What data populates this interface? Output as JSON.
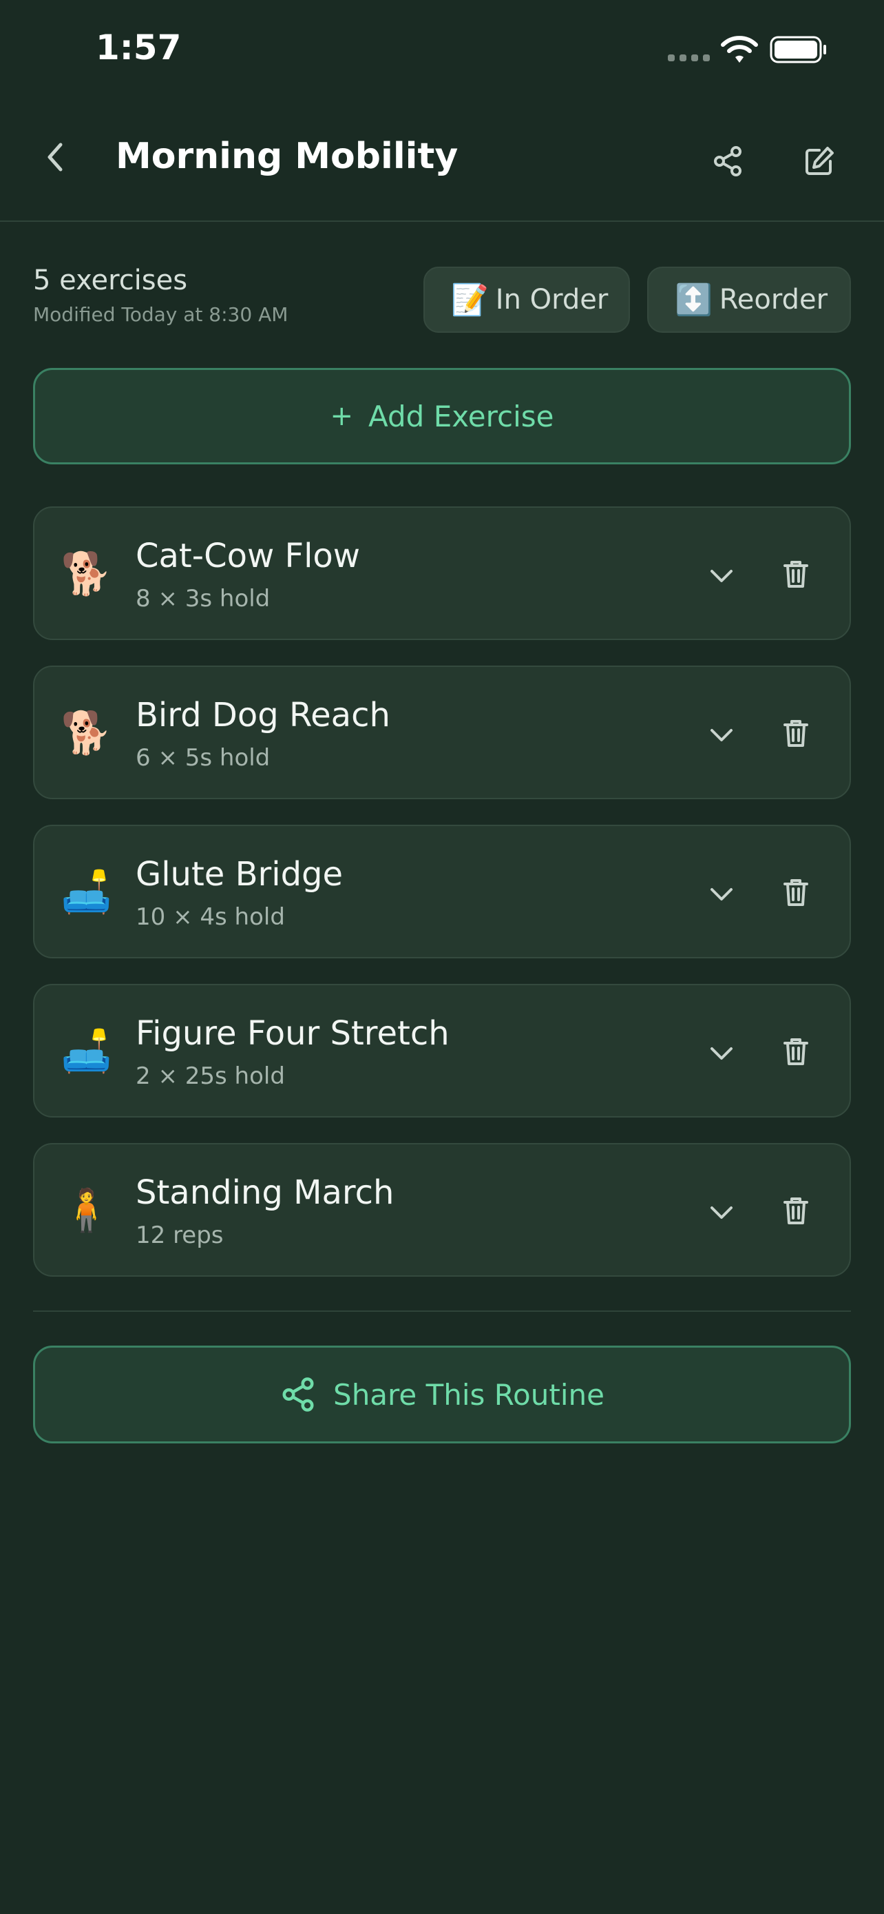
{
  "status_bar": {
    "time": "1:57"
  },
  "header": {
    "title": "Morning Mobility"
  },
  "summary": {
    "count": "5 exercises",
    "modified": "Modified Today at 8:30 AM",
    "in_order": {
      "emoji": "📝",
      "label": "In Order"
    },
    "reorder": {
      "emoji": "↕️",
      "label": "Reorder"
    }
  },
  "add_button": {
    "plus": "+",
    "label": "Add Exercise"
  },
  "exercises": [
    {
      "icon": "🐕",
      "name": "Cat-Cow Flow",
      "detail": "8 × 3s hold"
    },
    {
      "icon": "🐕",
      "name": "Bird Dog Reach",
      "detail": "6 × 5s hold"
    },
    {
      "icon": "🛋️",
      "name": "Glute Bridge",
      "detail": "10 × 4s hold"
    },
    {
      "icon": "🛋️",
      "name": "Figure Four Stretch",
      "detail": "2 × 25s hold"
    },
    {
      "icon": "🧍",
      "name": "Standing March",
      "detail": "12 reps"
    }
  ],
  "share_button": {
    "label": "Share This Routine"
  },
  "colors": {
    "background": "#1a2b23",
    "card": "#25392e",
    "accent": "#6fdca9",
    "accent_border": "#3a8163"
  }
}
